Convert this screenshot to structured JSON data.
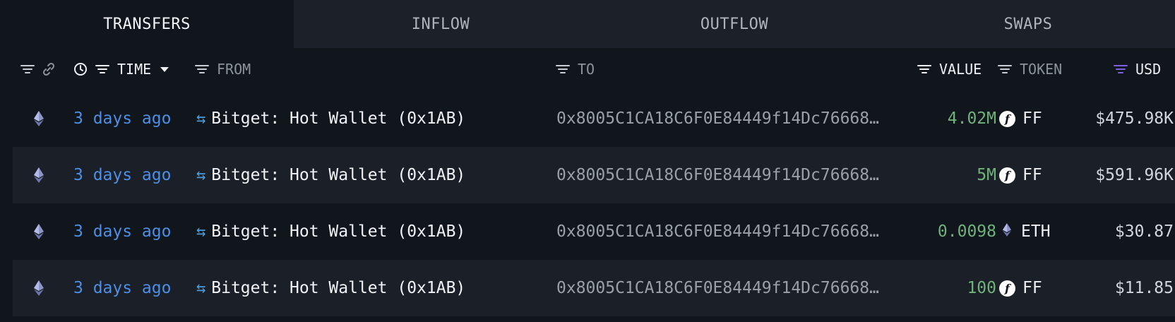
{
  "tabs": [
    {
      "label": "TRANSFERS",
      "active": true
    },
    {
      "label": "INFLOW",
      "active": false
    },
    {
      "label": "OUTFLOW",
      "active": false
    },
    {
      "label": "SWAPS",
      "active": false
    }
  ],
  "columns": {
    "time": "TIME",
    "from": "FROM",
    "to": "TO",
    "value": "VALUE",
    "token": "TOKEN",
    "usd": "USD"
  },
  "colors": {
    "time_link": "#4d8ee6",
    "value_positive": "#6fb27a",
    "usd_filter_accent": "#7b61e0"
  },
  "rows": [
    {
      "chain_icon": "ethereum-icon",
      "time": "3 days ago",
      "from": "Bitget: Hot Wallet (0x1AB)",
      "to": "0x8005C1CA18C6F0E84449f14Dc76668…",
      "value": "4.02M",
      "token_icon": "ff-token-icon",
      "token": "FF",
      "usd": "$475.98K"
    },
    {
      "chain_icon": "ethereum-icon",
      "time": "3 days ago",
      "from": "Bitget: Hot Wallet (0x1AB)",
      "to": "0x8005C1CA18C6F0E84449f14Dc76668…",
      "value": "5M",
      "token_icon": "ff-token-icon",
      "token": "FF",
      "usd": "$591.96K"
    },
    {
      "chain_icon": "ethereum-icon",
      "time": "3 days ago",
      "from": "Bitget: Hot Wallet (0x1AB)",
      "to": "0x8005C1CA18C6F0E84449f14Dc76668…",
      "value": "0.0098",
      "token_icon": "eth-token-icon",
      "token": "ETH",
      "usd": "$30.87"
    },
    {
      "chain_icon": "ethereum-icon",
      "time": "3 days ago",
      "from": "Bitget: Hot Wallet (0x1AB)",
      "to": "0x8005C1CA18C6F0E84449f14Dc76668…",
      "value": "100",
      "token_icon": "ff-token-icon",
      "token": "FF",
      "usd": "$11.85"
    }
  ]
}
